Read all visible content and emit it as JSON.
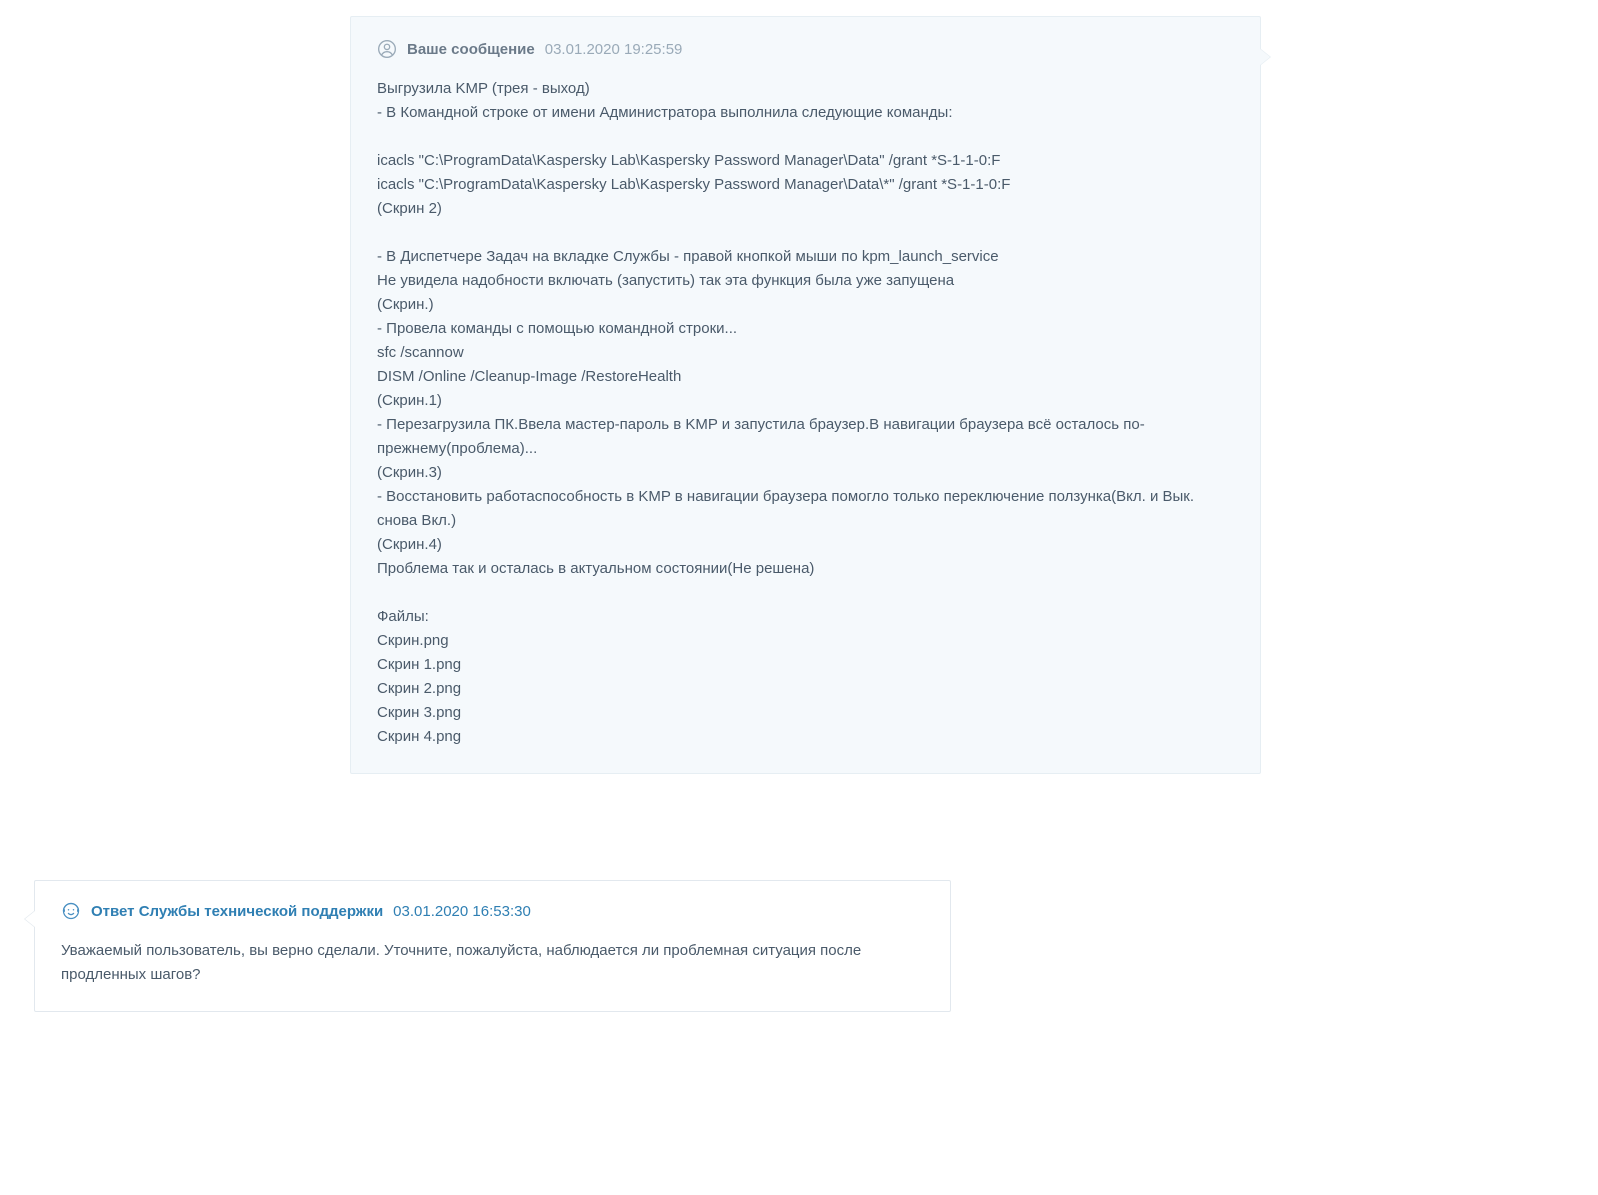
{
  "user_message": {
    "author_label": "Ваше сообщение",
    "timestamp": "03.01.2020 19:25:59",
    "body": "Выгрузила KMP (трея - выход)\n- В Командной строке от имени Администратора выполнила следующие команды:\n\nicacls \"C:\\ProgramData\\Kaspersky Lab\\Kaspersky Password Manager\\Data\" /grant *S-1-1-0:F\nicacls \"C:\\ProgramData\\Kaspersky Lab\\Kaspersky Password Manager\\Data\\*\" /grant *S-1-1-0:F\n(Скрин 2)\n\n- В Диспетчере Задач на вкладке Службы - правой кнопкой мыши по kpm_launch_service\nНе увидела надобности включать (запустить) так эта функция была уже запущена\n(Скрин.)\n- Провела команды с помощью командной строки...\nsfc /scannow\nDISM /Online /Cleanup-Image /RestoreHealth\n(Скрин.1)\n- Перезагрузила ПК.Ввела мастер-пароль в KMP и запустила браузер.В навигации браузера всё осталось по-прежнему(проблема)...\n(Скрин.3)\n- Восстановить работаспособность в KMP в навигации браузера помогло только переключение ползунка(Вкл. и Вык. снова Вкл.)\n(Скрин.4)\nПроблема так и осталась в актуальном состоянии(Не решена)\n\nФайлы:\nСкрин.png\nСкрин 1.png\nСкрин 2.png\nСкрин 3.png\nСкрин 4.png"
  },
  "support_message": {
    "author_label": "Ответ Службы технической поддержки",
    "timestamp": "03.01.2020 16:53:30",
    "body": "Уважаемый пользователь, вы верно сделали. Уточните, пожалуйста, наблюдается ли проблемная ситуация после продленных шагов?"
  }
}
